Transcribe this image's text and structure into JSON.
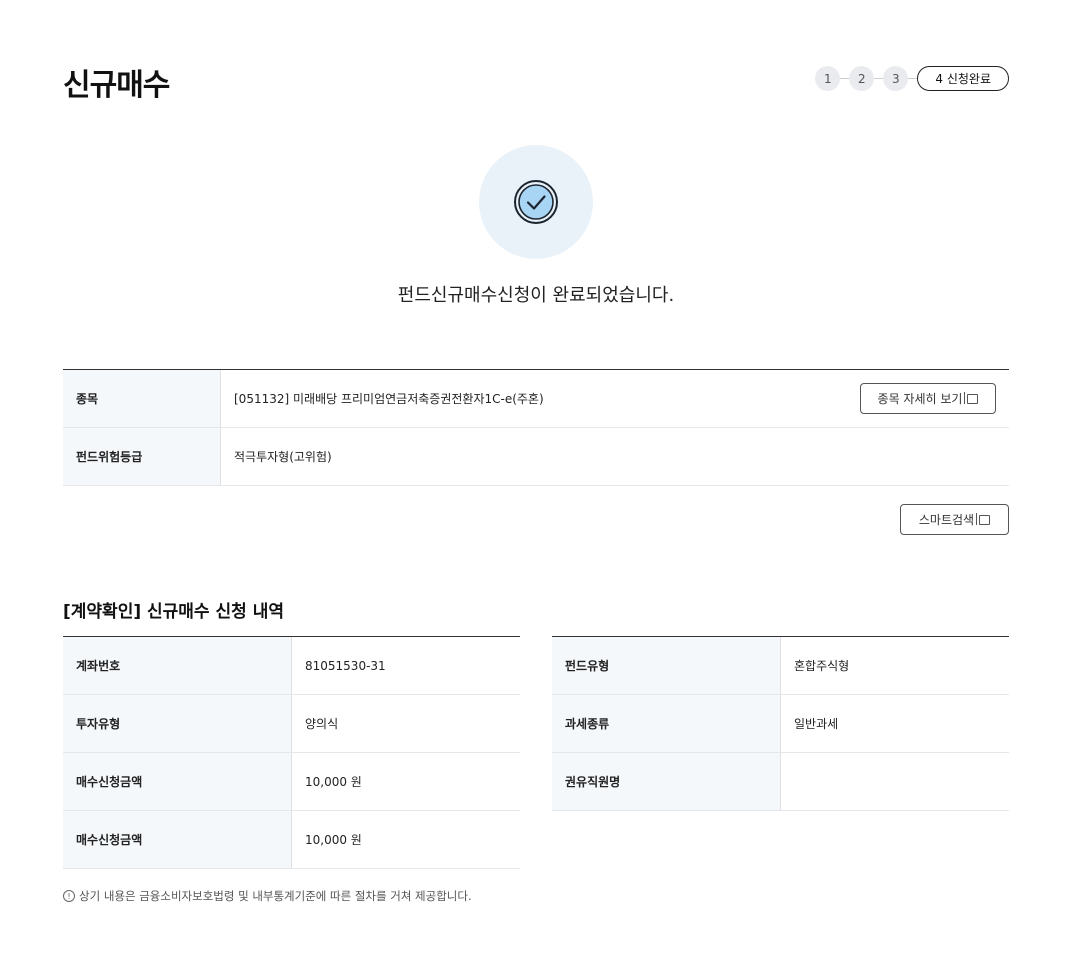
{
  "page": {
    "title": "신규매수"
  },
  "steps": {
    "items": [
      "1",
      "2",
      "3"
    ],
    "current_label": "4 신청완료"
  },
  "hero": {
    "icon": "check-circle-icon",
    "message": "펀드신규매수신청이 완료되었습니다."
  },
  "fund_info": {
    "rows": [
      {
        "label": "종목",
        "value": "[051132] 미래배당 프리미엄연금저축증권전환자1C-e(주혼)"
      },
      {
        "label": "펀드위험등급",
        "value": "적극투자형(고위험)"
      }
    ],
    "detail_button": "종목 자세히 보기"
  },
  "smart_search_button": "스마트검색",
  "contract": {
    "title": "[계약확인] 신규매수 신청 내역",
    "left": [
      {
        "label": "계좌번호",
        "value": "81051530-31"
      },
      {
        "label": "투자유형",
        "value": "양의식"
      },
      {
        "label": "매수신청금액",
        "value": "10,000 원"
      },
      {
        "label": "매수신청금액",
        "value": "10,000 원"
      }
    ],
    "right": [
      {
        "label": "펀드유형",
        "value": "혼합주식형"
      },
      {
        "label": "과세종류",
        "value": "일반과세"
      },
      {
        "label": "권유직원명",
        "value": ""
      }
    ]
  },
  "notice": "상기 내용은 금융소비자보호법령 및 내부통계기준에 따른 절차를 거쳐 제공합니다.",
  "colors": {
    "accent": "#1a6fb8",
    "hero_bg": "#eaf2f9",
    "table_header_bg": "#f5f8fb"
  }
}
